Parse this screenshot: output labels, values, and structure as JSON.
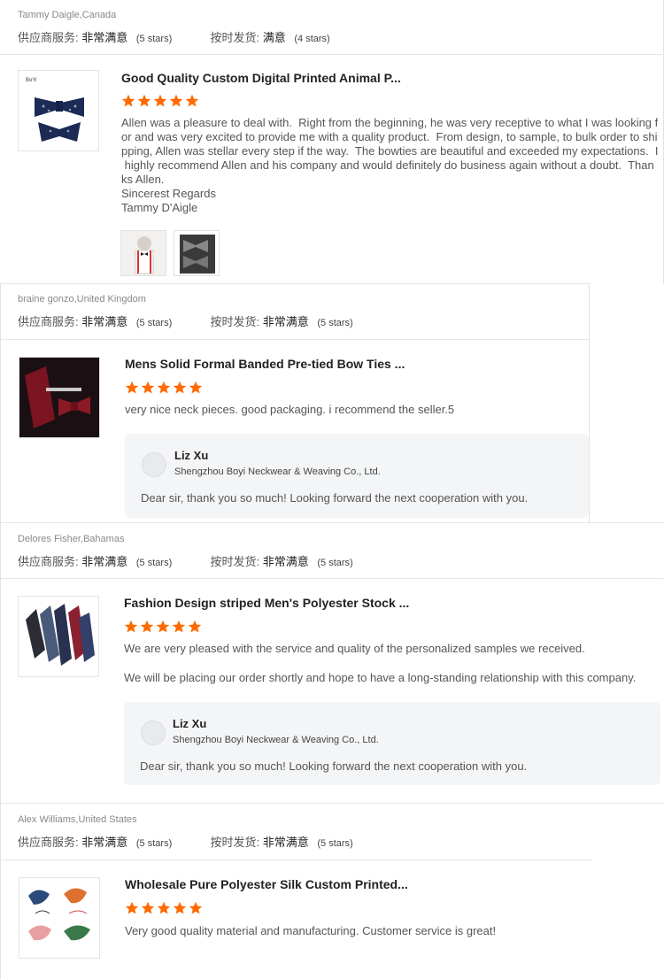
{
  "accent_color": "#ff6a00",
  "labels": {
    "supplier_service": "供应商服务:",
    "ontime_shipping": "按时发货:"
  },
  "reviews": [
    {
      "reviewer": "Tammy Daigle,Canada",
      "service_value": "非常满意",
      "service_stars": "(5 stars)",
      "shipping_value": "满意",
      "shipping_stars": "(4 stars)",
      "product_title": "Good Quality Custom Digital Printed Animal P...",
      "rating": 5,
      "comment_lines": [
        "Allen was a pleasure to deal with.  Right from the beginning, he was very receptive to what I was looking f",
        "or and was very excited to provide me with a quality product.  From design, to sample, to bulk order to shi",
        "pping, Allen was stellar every step if the way.  The bowties are beautiful and exceeded my expectations.  I",
        " highly recommend Allen and his company and would definitely do business again without a doubt.  Than",
        "ks Allen.",
        "Sincerest Regards",
        "Tammy D'Aigle"
      ]
    },
    {
      "reviewer": "braine gonzo,United Kingdom",
      "service_value": "非常满意",
      "service_stars": "(5 stars)",
      "shipping_value": "非常满意",
      "shipping_stars": "(5 stars)",
      "product_title": "Mens Solid Formal Banded Pre-tied Bow Ties ...",
      "rating": 5,
      "comment": "very nice neck pieces. good packaging. i recommend the seller.5",
      "reply": {
        "name": "Liz Xu",
        "company": "Shengzhou Boyi Neckwear & Weaving Co., Ltd.",
        "text": "Dear sir, thank you so much! Looking forward the next cooperation with you."
      }
    },
    {
      "reviewer": "Delores Fisher,Bahamas",
      "service_value": "非常满意",
      "service_stars": "(5 stars)",
      "shipping_value": "非常满意",
      "shipping_stars": "(5 stars)",
      "product_title": "Fashion Design striped Men's Polyester Stock ...",
      "rating": 5,
      "comment_lines": [
        "We are very pleased with the service and quality of the personalized samples we received.",
        "We will be placing our order shortly and hope to have a long-standing relationship with this company."
      ],
      "reply": {
        "name": "Liz Xu",
        "company": "Shengzhou Boyi Neckwear & Weaving Co., Ltd.",
        "text": "Dear sir, thank you so much! Looking forward the next cooperation with you."
      }
    },
    {
      "reviewer": "Alex Williams,United States",
      "service_value": "非常满意",
      "service_stars": "(5 stars)",
      "shipping_value": "非常满意",
      "shipping_stars": "(5 stars)",
      "product_title": "Wholesale Pure Polyester Silk Custom Printed...",
      "rating": 5,
      "comment": "Very good quality material and manufacturing. Customer service is great!"
    }
  ]
}
